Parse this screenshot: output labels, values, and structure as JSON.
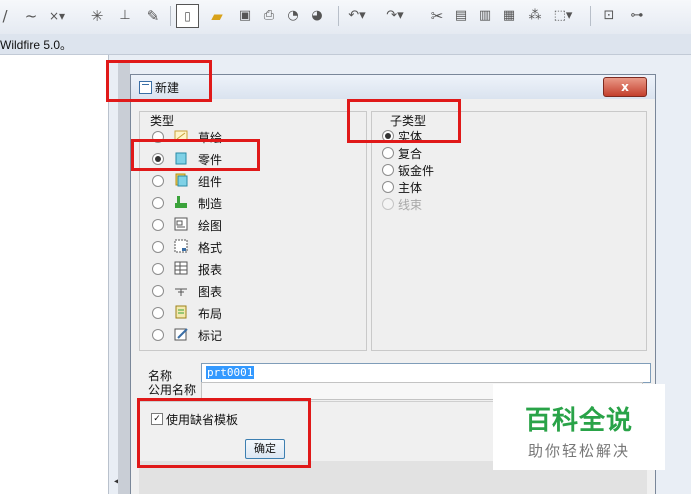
{
  "app": {
    "title": "Wildfire 5.0。",
    "toolbar_icons": [
      "curve-icon",
      "spline-icon",
      "datum-point-icon",
      "datum-plane-icon",
      "datum-axis-icon",
      "sketch-tool-icon",
      "new-file-icon",
      "open-folder-icon",
      "save-icon",
      "print-icon",
      "send-icon",
      "send-to-icon",
      "undo-icon",
      "redo-icon",
      "cut-icon",
      "copy-icon",
      "paste-icon",
      "paste-special-icon",
      "regenerate-icon",
      "select-box-icon",
      "window-icon",
      "model-tree-icon"
    ]
  },
  "dialog": {
    "title": "新建",
    "close_label": "x",
    "type_group_title": "类型",
    "types": [
      {
        "label": "草绘",
        "icon": "sketch-icon",
        "checked": false
      },
      {
        "label": "零件",
        "icon": "part-icon",
        "checked": true
      },
      {
        "label": "组件",
        "icon": "assembly-icon",
        "checked": false
      },
      {
        "label": "制造",
        "icon": "manufacturing-icon",
        "checked": false
      },
      {
        "label": "绘图",
        "icon": "drawing-icon",
        "checked": false
      },
      {
        "label": "格式",
        "icon": "format-icon",
        "checked": false
      },
      {
        "label": "报表",
        "icon": "report-icon",
        "checked": false
      },
      {
        "label": "图表",
        "icon": "diagram-icon",
        "checked": false
      },
      {
        "label": "布局",
        "icon": "layout-icon",
        "checked": false
      },
      {
        "label": "标记",
        "icon": "markup-icon",
        "checked": false
      }
    ],
    "subtype_group_title": "子类型",
    "subtypes": [
      {
        "label": "实体",
        "checked": true,
        "disabled": false
      },
      {
        "label": "复合",
        "checked": false,
        "disabled": false
      },
      {
        "label": "钣金件",
        "checked": false,
        "disabled": false
      },
      {
        "label": "主体",
        "checked": false,
        "disabled": false
      },
      {
        "label": "线束",
        "checked": false,
        "disabled": true
      }
    ],
    "name_label": "名称",
    "name_value": "prt0001",
    "common_name_label": "公用名称",
    "common_name_value": "",
    "use_default_template_label": "使用缺省模板",
    "use_default_template_checked": true,
    "checkbox_mark": "✓",
    "ok_label": "确定"
  },
  "watermark": {
    "title": "百科全说",
    "subtitle": "助你轻松解决"
  },
  "colors": {
    "highlight": "#e01919",
    "watermark_green": "#29a348",
    "selection_blue": "#3399ff"
  }
}
